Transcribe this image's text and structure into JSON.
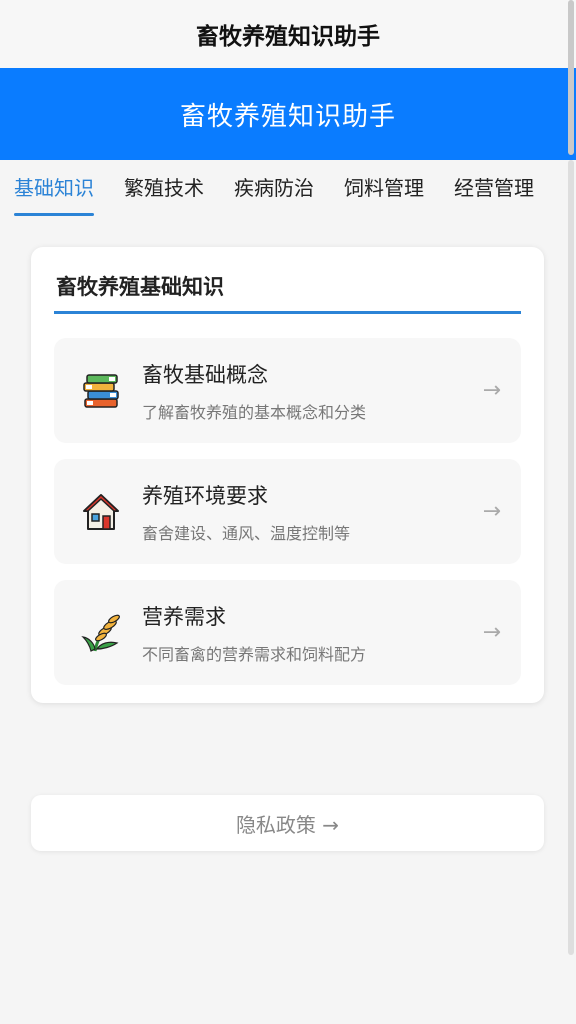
{
  "topbar": {
    "title": "畜牧养殖知识助手"
  },
  "banner": {
    "title": "畜牧养殖知识助手"
  },
  "tabs": [
    {
      "label": "基础知识",
      "active": true
    },
    {
      "label": "繁殖技术"
    },
    {
      "label": "疾病防治"
    },
    {
      "label": "饲料管理"
    },
    {
      "label": "经营管理"
    }
  ],
  "card": {
    "heading": "畜牧养殖基础知识",
    "items": [
      {
        "title": "畜牧基础概念",
        "subtitle": "了解畜牧养殖的基本概念和分类",
        "icon": "books-icon",
        "arrow": "→"
      },
      {
        "title": "养殖环境要求",
        "subtitle": "畜舍建设、通风、温度控制等",
        "icon": "house-icon",
        "arrow": "→"
      },
      {
        "title": "营养需求",
        "subtitle": "不同畜禽的营养需求和饲料配方",
        "icon": "wheat-icon",
        "arrow": "→"
      }
    ]
  },
  "privacy": {
    "label": "隐私政策 →"
  },
  "colors": {
    "accent": "#2b83d6",
    "banner": "#0a7cff"
  }
}
